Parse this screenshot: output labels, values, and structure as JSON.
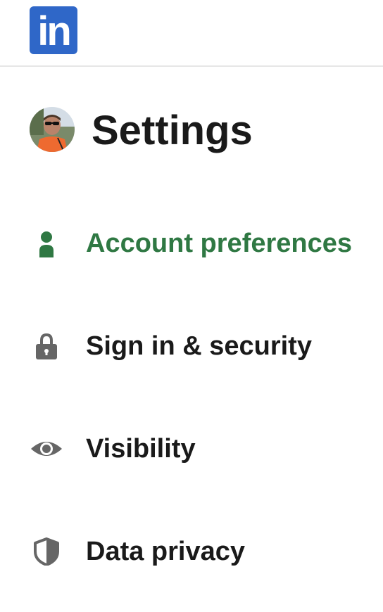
{
  "app": {
    "logo_text": "in"
  },
  "header": {
    "title": "Settings"
  },
  "menu": {
    "items": [
      {
        "label": "Account preferences",
        "icon": "person-icon",
        "active": true
      },
      {
        "label": "Sign in & security",
        "icon": "lock-icon",
        "active": false
      },
      {
        "label": "Visibility",
        "icon": "eye-icon",
        "active": false
      },
      {
        "label": "Data privacy",
        "icon": "shield-icon",
        "active": false
      }
    ]
  },
  "colors": {
    "brand": "#2f67c8",
    "active": "#2f7843",
    "text": "#1a1a1a",
    "icon": "#666666"
  }
}
